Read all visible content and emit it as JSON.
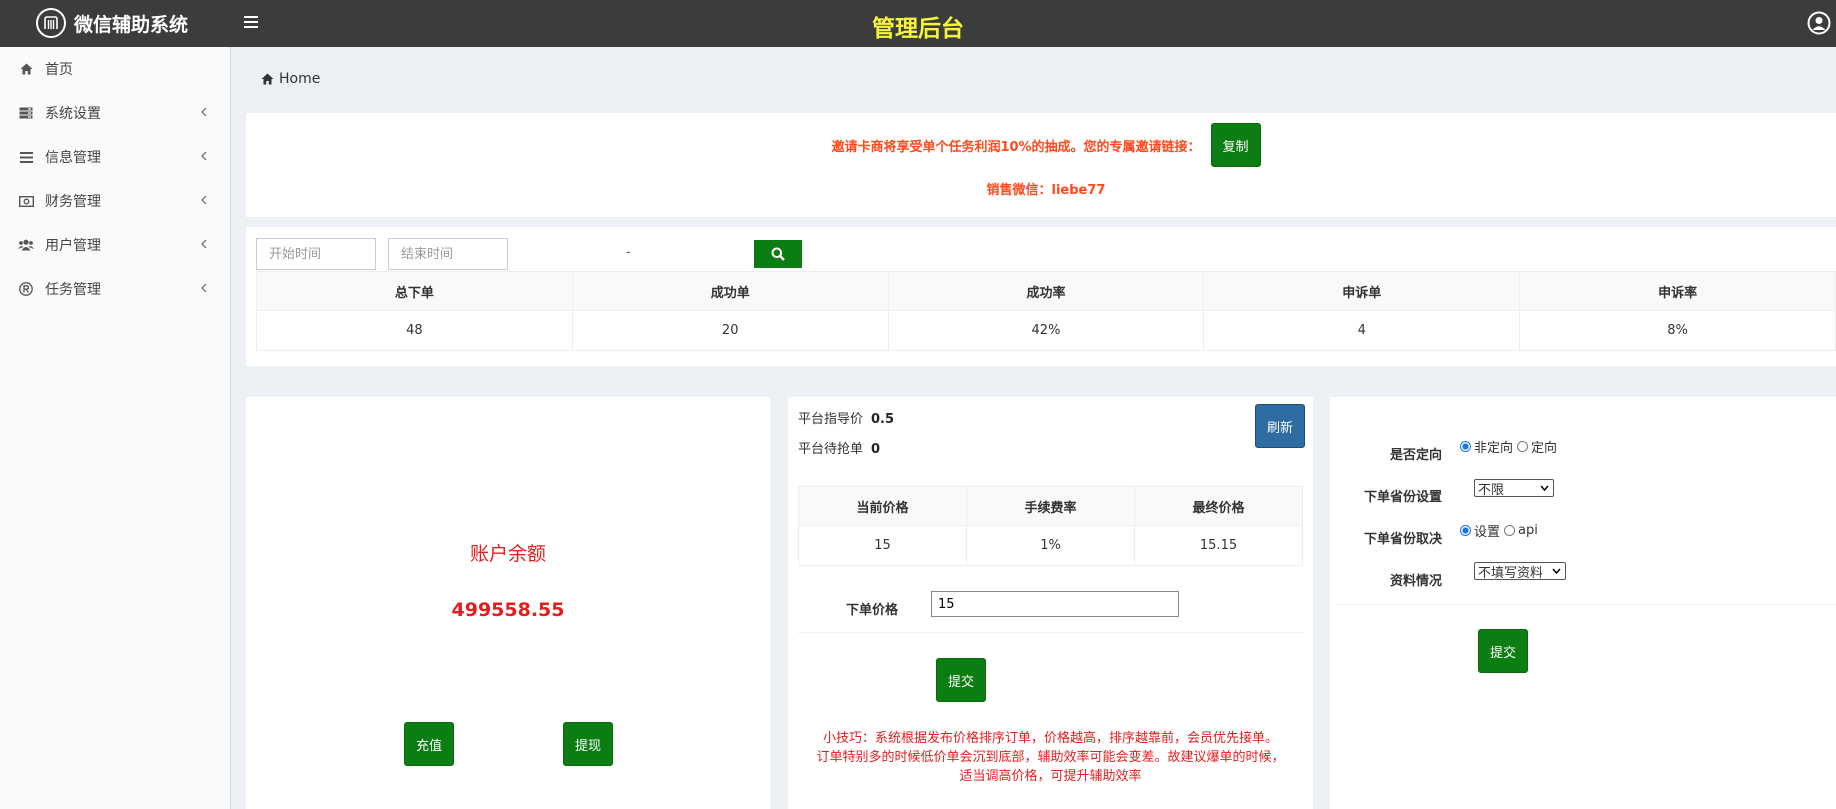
{
  "header": {
    "app_name": "微信辅助系统",
    "center_title": "管理后台"
  },
  "sidebar": {
    "items": [
      {
        "label": "首页",
        "icon": "home-icon"
      },
      {
        "label": "系统设置",
        "icon": "server-icon"
      },
      {
        "label": "信息管理",
        "icon": "list-icon"
      },
      {
        "label": "财务管理",
        "icon": "money-icon"
      },
      {
        "label": "用户管理",
        "icon": "users-icon"
      },
      {
        "label": "任务管理",
        "icon": "registered-icon"
      }
    ]
  },
  "breadcrumb": {
    "home": "Home"
  },
  "invite": {
    "text": "邀请卡商将享受单个任务利润10%的抽成。您的专属邀请链接：",
    "copy_label": "复制",
    "sales": "销售微信：liebe77"
  },
  "filters": {
    "start_placeholder": "开始时间",
    "end_placeholder": "结束时间",
    "separator": "-"
  },
  "stats": {
    "headers": [
      "总下单",
      "成功单",
      "成功率",
      "申诉单",
      "申诉率"
    ],
    "values": [
      "48",
      "20",
      "42%",
      "4",
      "8%"
    ]
  },
  "balance": {
    "label": "账户余额",
    "value": "499558.55",
    "recharge_label": "充值",
    "withdraw_label": "提现"
  },
  "pricing": {
    "guide_label": "平台指导价",
    "guide_value": "0.5",
    "pending_label": "平台待抢单",
    "pending_value": "0",
    "refresh_label": "刷新",
    "headers": [
      "当前价格",
      "手续费率",
      "最终价格"
    ],
    "values": [
      "15",
      "1%",
      "15.15"
    ],
    "order_price_label": "下单价格",
    "order_price_value": "15",
    "submit_label": "提交",
    "tip_lines": [
      "小技巧：系统根据发布价格排序订单，价格越高，排序越靠前，会员优先接单。",
      "订单特别多的时候低价单会沉到底部，辅助效率可能会变差。故建议爆单的时候，",
      "适当调高价格，可提升辅助效率"
    ]
  },
  "settings": {
    "targeted_label": "是否定向",
    "targeted_options": [
      "非定向",
      "定向"
    ],
    "targeted_selected": "非定向",
    "province_label": "下单省份设置",
    "province_value": "不限",
    "province_source_label": "下单省份取决",
    "province_source_options": [
      "设置",
      "api"
    ],
    "province_source_selected": "设置",
    "info_label": "资料情况",
    "info_value": "不填写资料",
    "submit_label": "提交"
  },
  "colors": {
    "topbar": "#3c3c3c",
    "title_yellow": "#f5f53c",
    "green": "#0b7d12",
    "blue": "#2e6da4",
    "red": "#e41e1e",
    "orange": "#ff4a1d"
  }
}
